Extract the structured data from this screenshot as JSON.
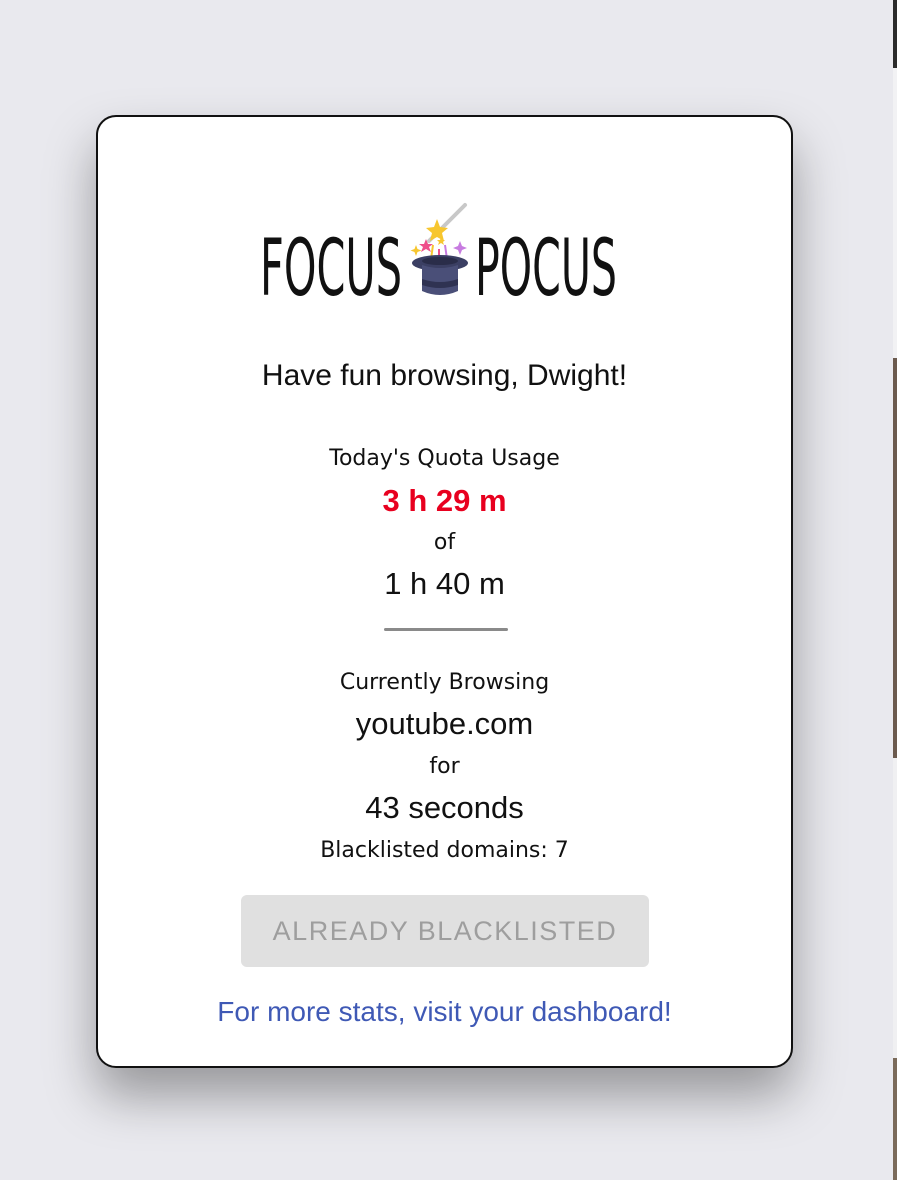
{
  "app": {
    "logo_left": "FOCUS",
    "logo_right": "POCUS",
    "logo_icon": "magic-hat-icon"
  },
  "greeting": "Have fun browsing, Dwight!",
  "quota": {
    "label": "Today's Quota Usage",
    "used": "3 h 29 m",
    "of_label": "of",
    "total": "1 h 40 m",
    "progress_percent": 100,
    "used_color": "#e8001f"
  },
  "browsing": {
    "label": "Currently Browsing",
    "domain": "youtube.com",
    "for_label": "for",
    "duration": "43 seconds",
    "blacklisted_domains": "Blacklisted domains: 7"
  },
  "actions": {
    "blacklist_button_label": "ALREADY BLACKLISTED",
    "blacklist_button_disabled": true,
    "dashboard_link_text": "For more stats, visit your dashboard!",
    "link_color": "#3f59b5"
  }
}
